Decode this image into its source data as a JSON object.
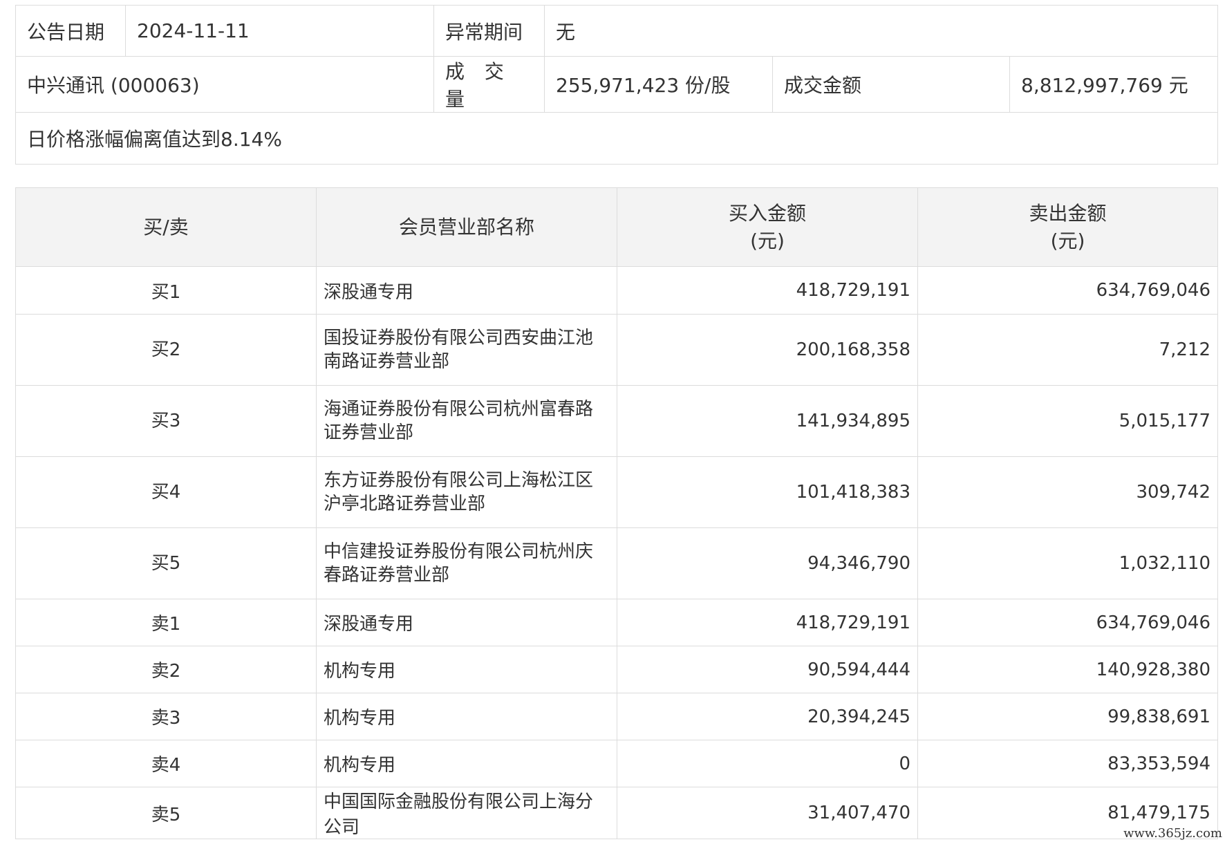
{
  "summary": {
    "date_label": "公告日期",
    "date_value": "2024-11-11",
    "period_label": "异常期间",
    "period_value": "无",
    "stock": "中兴通讯 (000063)",
    "volume_label": "成 交 量",
    "volume_value": "255,971,423 份/股",
    "amount_label": "成交金额",
    "amount_value": "8,812,997,769 元",
    "reason": "日价格涨幅偏离值达到8.14%"
  },
  "seats": {
    "headers": {
      "side": "买/卖",
      "name": "会员营业部名称",
      "buy": "买入金额",
      "buy_unit": "(元)",
      "sell": "卖出金额",
      "sell_unit": "(元)"
    },
    "rows": [
      {
        "side": "买1",
        "name": "深股通专用",
        "buy": "418,729,191",
        "sell": "634,769,046"
      },
      {
        "side": "买2",
        "name": "国投证券股份有限公司西安曲江池南路证券营业部",
        "buy": "200,168,358",
        "sell": "7,212"
      },
      {
        "side": "买3",
        "name": "海通证券股份有限公司杭州富春路证券营业部",
        "buy": "141,934,895",
        "sell": "5,015,177"
      },
      {
        "side": "买4",
        "name": "东方证券股份有限公司上海松江区沪亭北路证券营业部",
        "buy": "101,418,383",
        "sell": "309,742"
      },
      {
        "side": "买5",
        "name": "中信建投证券股份有限公司杭州庆春路证券营业部",
        "buy": "94,346,790",
        "sell": "1,032,110"
      },
      {
        "side": "卖1",
        "name": "深股通专用",
        "buy": "418,729,191",
        "sell": "634,769,046"
      },
      {
        "side": "卖2",
        "name": "机构专用",
        "buy": "90,594,444",
        "sell": "140,928,380"
      },
      {
        "side": "卖3",
        "name": "机构专用",
        "buy": "20,394,245",
        "sell": "99,838,691"
      },
      {
        "side": "卖4",
        "name": "机构专用",
        "buy": "0",
        "sell": "83,353,594"
      },
      {
        "side": "卖5",
        "name": "中国国际金融股份有限公司上海分公司",
        "buy": "31,407,470",
        "sell": "81,479,175"
      }
    ]
  },
  "watermark": "www.365jz.com"
}
